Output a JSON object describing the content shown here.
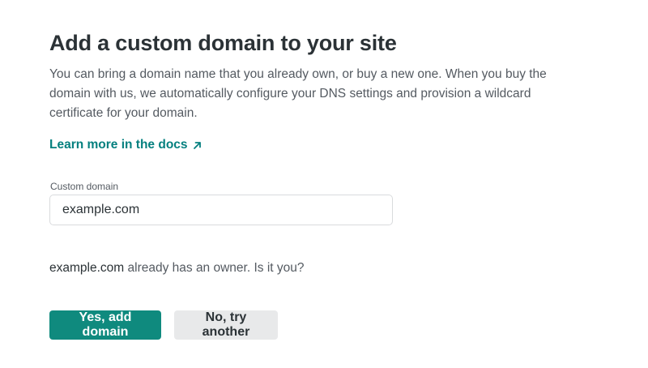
{
  "header": {
    "title": "Add a custom domain to your site",
    "description": "You can bring a domain name that you already own, or buy a new one. When you buy the domain with us, we automatically configure your DNS settings and provision a wildcard certificate for your domain."
  },
  "docs_link": {
    "label": "Learn more in the docs",
    "icon": "external-arrow-icon"
  },
  "form": {
    "field_label": "Custom domain",
    "field_value": "example.com"
  },
  "ownership": {
    "domain": "example.com",
    "message": "already has an owner. Is it you?"
  },
  "actions": {
    "confirm_label": "Yes, add domain",
    "retry_label": "No, try another"
  },
  "colors": {
    "accent": "#0f8a7e",
    "link": "#05807f",
    "secondary_button": "#e8e9ea"
  }
}
